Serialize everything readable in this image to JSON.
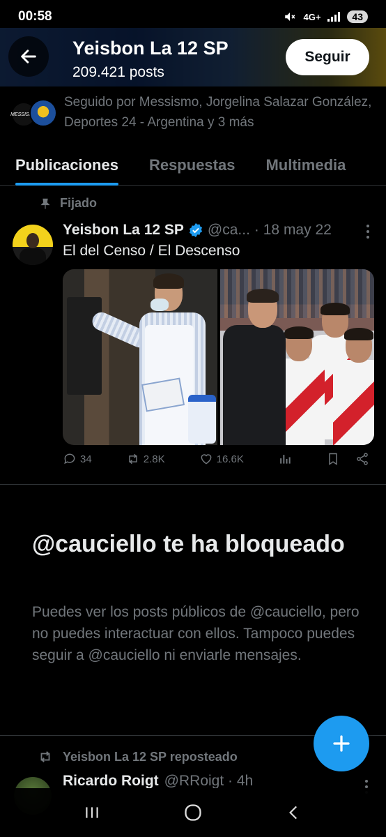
{
  "status": {
    "time": "00:58",
    "network": "4G+",
    "battery": "43"
  },
  "header": {
    "title": "Yeisbon La 12 SP",
    "posts_count": "209.421 posts",
    "follow_label": "Seguir"
  },
  "followed_by": "Seguido por Messismo, Jorgelina Salazar González, Deportes 24 - Argentina y 3 más",
  "followed_avatar_text": "MESSISMO",
  "tabs": [
    {
      "label": "Publicaciones",
      "active": true
    },
    {
      "label": "Respuestas",
      "active": false
    },
    {
      "label": "Multimedia",
      "active": false
    }
  ],
  "pinned_tweet": {
    "pinned_label": "Fijado",
    "name": "Yeisbon La 12 SP",
    "handle": "@ca...",
    "date": "· 18 may 22",
    "text": "El del Censo / El Descenso",
    "replies": "34",
    "reposts": "2.8K",
    "likes": "16.6K"
  },
  "blocked": {
    "title": "@cauciello te ha bloqueado",
    "body": "Puedes ver los posts públicos de @cauciello, pero no puedes interactuar con ellos. Tampoco puedes seguir a @cauciello ni enviarle mensajes."
  },
  "next_post": {
    "repost_label": "Yeisbon La 12 SP reposteado",
    "name": "Ricardo Roigt",
    "handle": "@RRoigt · 4h"
  },
  "colors": {
    "accent": "#1d9bf0",
    "muted": "#71767b",
    "text": "#e7e9ea",
    "background": "#000000"
  }
}
